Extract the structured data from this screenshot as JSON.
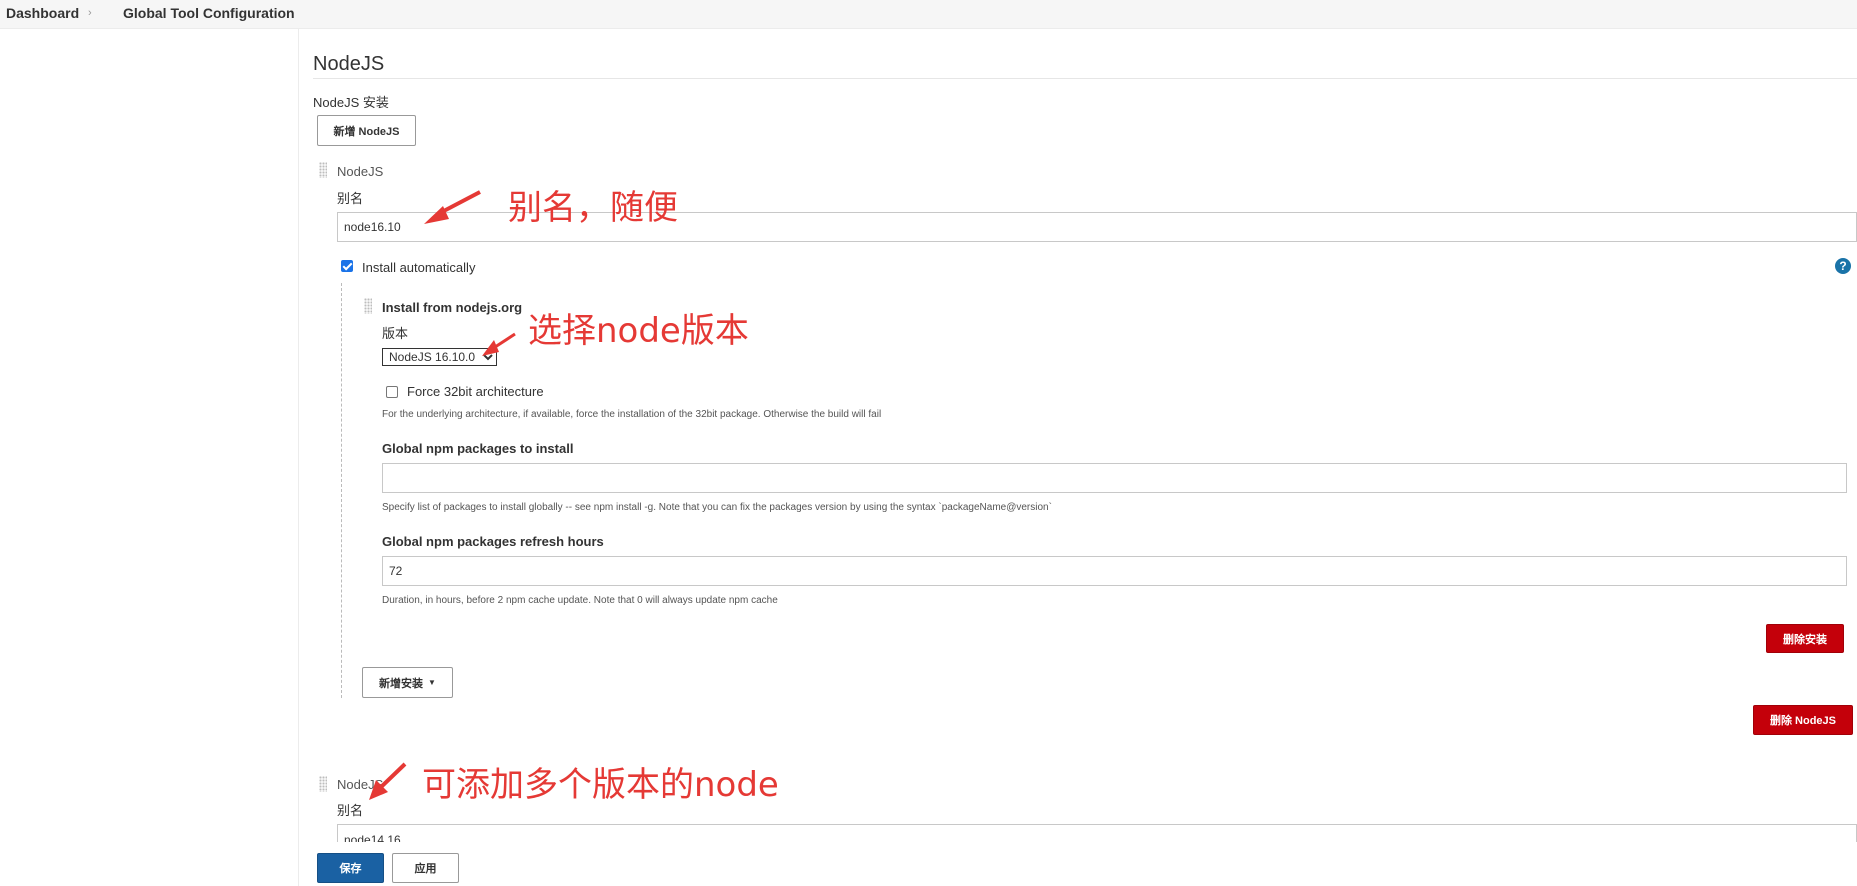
{
  "breadcrumb": {
    "items": [
      "Dashboard",
      "Global Tool Configuration"
    ],
    "separator": "›"
  },
  "section": {
    "title": "NodeJS",
    "installations_label": "NodeJS 安装",
    "add_nodejs_button": "新增 NodeJS"
  },
  "node1": {
    "header": "NodeJS",
    "alias_label": "别名",
    "alias_value": "node16.10",
    "install_auto_label": "Install automatically",
    "install_auto_checked": true,
    "help_icon_text": "?",
    "installer": {
      "title": "Install from nodejs.org",
      "version_label": "版本",
      "version_selected": "NodeJS 16.10.0",
      "force32_label": "Force 32bit architecture",
      "force32_desc": "For the underlying architecture, if available, force the installation of the 32bit package. Otherwise the build will fail",
      "npm_label": "Global npm packages to install",
      "npm_value": "",
      "npm_desc": "Specify list of packages to install globally -- see npm install -g. Note that you can fix the packages version by using the syntax `packageName@version`",
      "refresh_label": "Global npm packages refresh hours",
      "refresh_value": "72",
      "refresh_desc": "Duration, in hours, before 2 npm cache update. Note that 0 will always update npm cache",
      "delete_installer_button": "删除安装"
    },
    "add_installer_button": "新增安装",
    "delete_nodejs_button": "删除 NodeJS"
  },
  "node2": {
    "header": "NodeJS",
    "alias_label": "别名",
    "alias_value": "node14.16"
  },
  "footer": {
    "save_button": "保存",
    "apply_button": "应用"
  },
  "annotations": {
    "alias_note": "别名，随便",
    "version_note": "选择node版本",
    "multi_note": "可添加多个版本的node"
  },
  "colors": {
    "annotation": "#e53935",
    "danger": "#c4000a",
    "primary": "#1a61a3"
  }
}
